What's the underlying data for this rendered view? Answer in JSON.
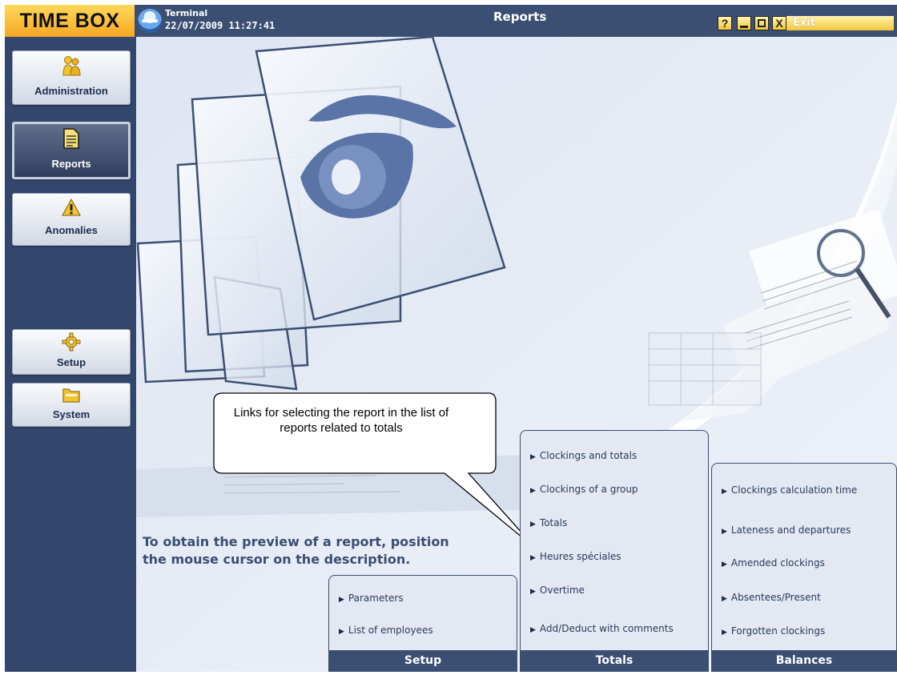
{
  "header": {
    "brand": "TIME BOX",
    "terminal_label": "Terminal",
    "datetime": "22/07/2009 11:27:41",
    "title": "Reports",
    "help_btn": "?",
    "min_btn": "‒",
    "max_btn": "□",
    "close_btn": "X",
    "exit": "Exit"
  },
  "sidebar": {
    "items": [
      {
        "label": "Administration",
        "icon": "users-icon",
        "active": false
      },
      {
        "label": "Reports",
        "icon": "document-icon",
        "active": true
      },
      {
        "label": "Anomalies",
        "icon": "warning-icon",
        "active": false
      },
      {
        "label": "Setup",
        "icon": "gear-icon",
        "active": false
      },
      {
        "label": "System",
        "icon": "folder-icon",
        "active": false
      }
    ]
  },
  "callout": {
    "text": "Links for selecting the report in the list of reports related to totals"
  },
  "instructions": {
    "line1": "To obtain the preview of a report, position",
    "line2": "the mouse cursor on the description."
  },
  "panels": {
    "setup": {
      "title": "Setup",
      "links": [
        "Parameters",
        "List of employees"
      ]
    },
    "totals": {
      "title": "Totals",
      "links": [
        "Clockings and totals",
        "Clockings of a group",
        "Totals",
        "Heures spéciales",
        "Overtime",
        "Add/Deduct with comments"
      ]
    },
    "balances": {
      "title": "Balances",
      "links": [
        "Clockings calculation time",
        "Lateness and departures",
        "Amended clockings",
        "Absentees/Present",
        "Forgotten clockings"
      ]
    }
  },
  "colors": {
    "sidebar": "#33466b",
    "accent": "#f5a823",
    "background": "#e7ecf6"
  }
}
